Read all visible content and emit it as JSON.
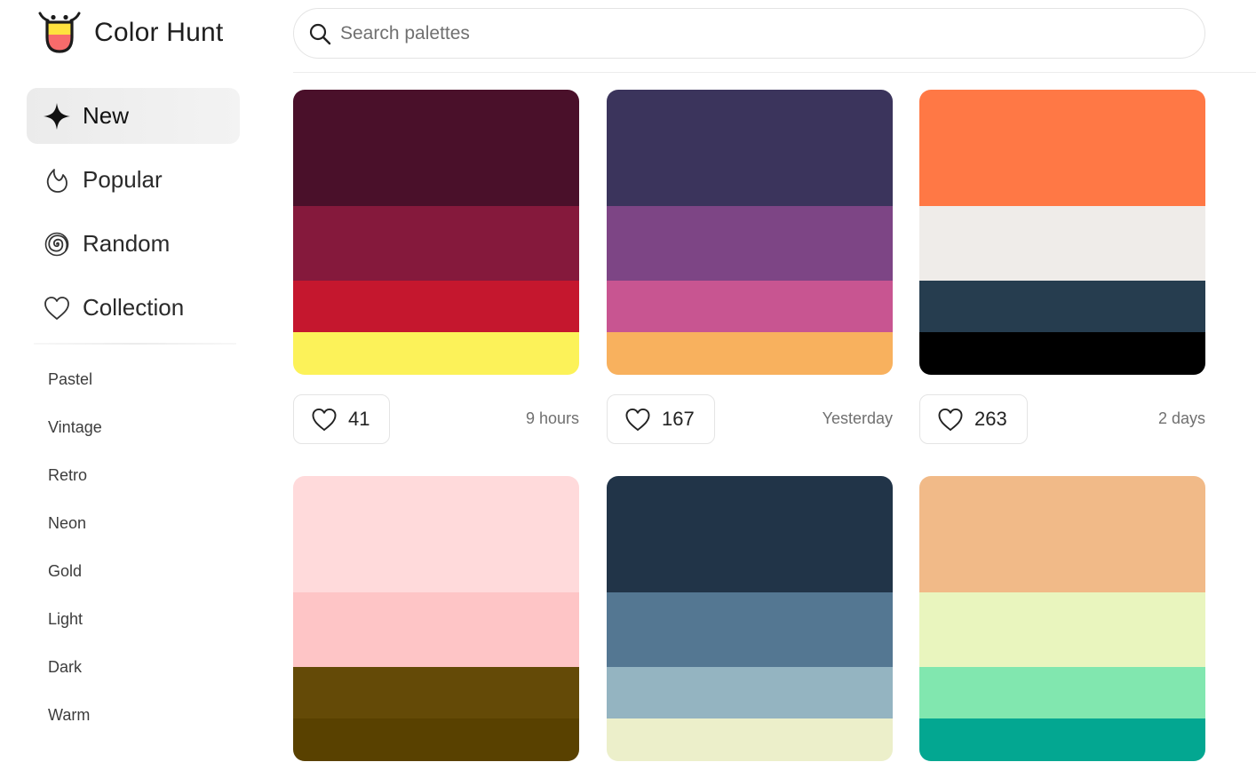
{
  "app": {
    "name": "Color Hunt"
  },
  "search": {
    "placeholder": "Search palettes"
  },
  "nav": [
    {
      "label": "New",
      "icon": "sparkle-icon",
      "active": true
    },
    {
      "label": "Popular",
      "icon": "flame-icon",
      "active": false
    },
    {
      "label": "Random",
      "icon": "spiral-icon",
      "active": false
    },
    {
      "label": "Collection",
      "icon": "heart-icon",
      "active": false
    }
  ],
  "tags": [
    "Pastel",
    "Vintage",
    "Retro",
    "Neon",
    "Gold",
    "Light",
    "Dark",
    "Warm"
  ],
  "palettes": [
    {
      "colors": [
        "#4A102A",
        "#85193C",
        "#C5172E",
        "#FCF259"
      ],
      "likes": "41",
      "time": "9 hours"
    },
    {
      "colors": [
        "#3B345C",
        "#7D4585",
        "#C85591",
        "#F8B15E"
      ],
      "likes": "167",
      "time": "Yesterday"
    },
    {
      "colors": [
        "#FF7845",
        "#EFECE9",
        "#263D4F",
        "#000000"
      ],
      "likes": "263",
      "time": "2 days"
    },
    {
      "colors": [
        "#FFDADB",
        "#FEC5C6",
        "#644A07",
        "#594100"
      ],
      "likes": null,
      "time": null
    },
    {
      "colors": [
        "#213448",
        "#547792",
        "#94B4C1",
        "#ECEFCA"
      ],
      "likes": null,
      "time": null
    },
    {
      "colors": [
        "#F1BA88",
        "#E9F5BE",
        "#81E7AF",
        "#03A791"
      ],
      "likes": null,
      "time": null
    }
  ]
}
